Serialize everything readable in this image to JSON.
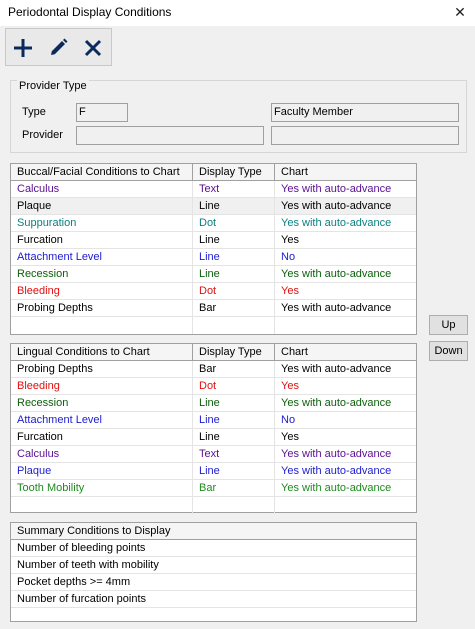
{
  "window": {
    "title": "Periodontal Display Conditions",
    "close_glyph": "✕"
  },
  "toolbar": {
    "add_icon": "plus-icon",
    "edit_icon": "pencil-icon",
    "delete_icon": "x-icon"
  },
  "provider_type": {
    "legend": "Provider Type",
    "type_label": "Type",
    "type_value": "F",
    "type_desc": "Faculty Member",
    "provider_label": "Provider",
    "provider_value": "",
    "provider_desc": ""
  },
  "buccal": {
    "headers": [
      "Buccal/Facial Conditions to Chart",
      "Display Type",
      "Chart"
    ],
    "rows": [
      {
        "condition": "Calculus",
        "display": "Text",
        "chart": "Yes with auto-advance",
        "color": "#5b0f91"
      },
      {
        "condition": "Plaque",
        "display": "Line",
        "chart": "Yes with auto-advance",
        "color": "#000000",
        "selected": true
      },
      {
        "condition": "Suppuration",
        "display": "Dot",
        "chart": "Yes with auto-advance",
        "color": "#0b8080"
      },
      {
        "condition": "Furcation",
        "display": "Line",
        "chart": "Yes",
        "color": "#000000"
      },
      {
        "condition": "Attachment Level",
        "display": "Line",
        "chart": "No",
        "color": "#1c1cd0"
      },
      {
        "condition": "Recession",
        "display": "Line",
        "chart": "Yes with auto-advance",
        "color": "#0b5e0b"
      },
      {
        "condition": "Bleeding",
        "display": "Dot",
        "chart": "Yes",
        "color": "#e01010"
      },
      {
        "condition": "Probing Depths",
        "display": "Bar",
        "chart": "Yes with auto-advance",
        "color": "#000000"
      }
    ]
  },
  "lingual": {
    "headers": [
      "Lingual Conditions to Chart",
      "Display Type",
      "Chart"
    ],
    "rows": [
      {
        "condition": "Probing Depths",
        "display": "Bar",
        "chart": "Yes with auto-advance",
        "color": "#000000"
      },
      {
        "condition": "Bleeding",
        "display": "Dot",
        "chart": "Yes",
        "color": "#e01010"
      },
      {
        "condition": "Recession",
        "display": "Line",
        "chart": "Yes with auto-advance",
        "color": "#0b5e0b"
      },
      {
        "condition": "Attachment Level",
        "display": "Line",
        "chart": "No",
        "color": "#1c1cd0"
      },
      {
        "condition": "Furcation",
        "display": "Line",
        "chart": "Yes",
        "color": "#000000"
      },
      {
        "condition": "Calculus",
        "display": "Text",
        "chart": "Yes with auto-advance",
        "color": "#5b0f91"
      },
      {
        "condition": "Plaque",
        "display": "Line",
        "chart": "Yes with auto-advance",
        "color": "#1c1cd0"
      },
      {
        "condition": "Tooth Mobility",
        "display": "Bar",
        "chart": "Yes with auto-advance",
        "color": "#1f8a1f"
      }
    ]
  },
  "buttons": {
    "up": "Up",
    "down": "Down"
  },
  "summary": {
    "header": "Summary Conditions to Display",
    "rows": [
      "Number of bleeding points",
      "Number of teeth with mobility",
      "Pocket depths >= 4mm",
      "Number of furcation points"
    ]
  }
}
